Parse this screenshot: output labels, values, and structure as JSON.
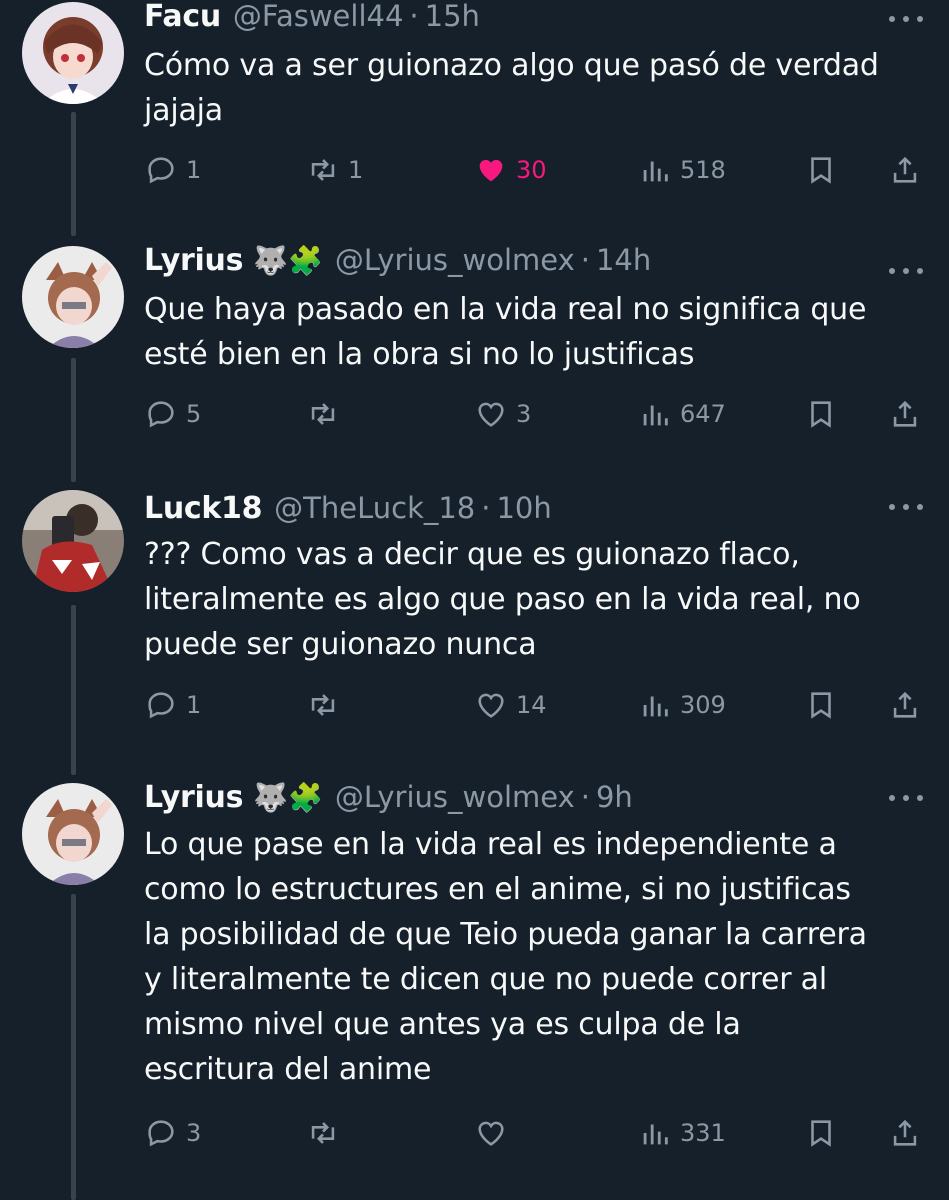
{
  "colors": {
    "background": "#15202b",
    "text": "#f7f9f9",
    "muted": "#8b98a5",
    "like": "#f91880",
    "thread": "#38444d"
  },
  "tweets": [
    {
      "name": "Facu",
      "emoji": "",
      "handle": "@Faswell44",
      "time": "15h",
      "text": "Cómo va a ser guionazo algo que pasó de verdad\njajaja",
      "replies": "1",
      "retweets": "1",
      "likes": "30",
      "views": "518",
      "liked": true
    },
    {
      "name": "Lyrius",
      "emoji": "🐺🧩",
      "handle": "@Lyrius_wolmex",
      "time": "14h",
      "text": "Que haya pasado en la vida real no significa que\nesté bien en la obra si no lo justificas",
      "replies": "5",
      "retweets": "",
      "likes": "3",
      "views": "647",
      "liked": false
    },
    {
      "name": "Luck18",
      "emoji": "",
      "handle": "@TheLuck_18",
      "time": "10h",
      "text": "??? Como vas a decir que es guionazo flaco,\nliteralmente es algo que paso en la vida real, no\npuede ser guionazo nunca",
      "replies": "1",
      "retweets": "",
      "likes": "14",
      "views": "309",
      "liked": false
    },
    {
      "name": "Lyrius",
      "emoji": "🐺🧩",
      "handle": "@Lyrius_wolmex",
      "time": "9h",
      "text": "Lo que pase en la vida real es independiente a\ncomo lo estructures en el anime, si no justificas\nla posibilidad de que Teio pueda ganar la carrera\ny literalmente te dicen que no puede correr al\nmismo nivel que antes ya es culpa de la\nescritura del anime",
      "replies": "3",
      "retweets": "",
      "likes": "",
      "views": "331",
      "liked": false
    }
  ]
}
